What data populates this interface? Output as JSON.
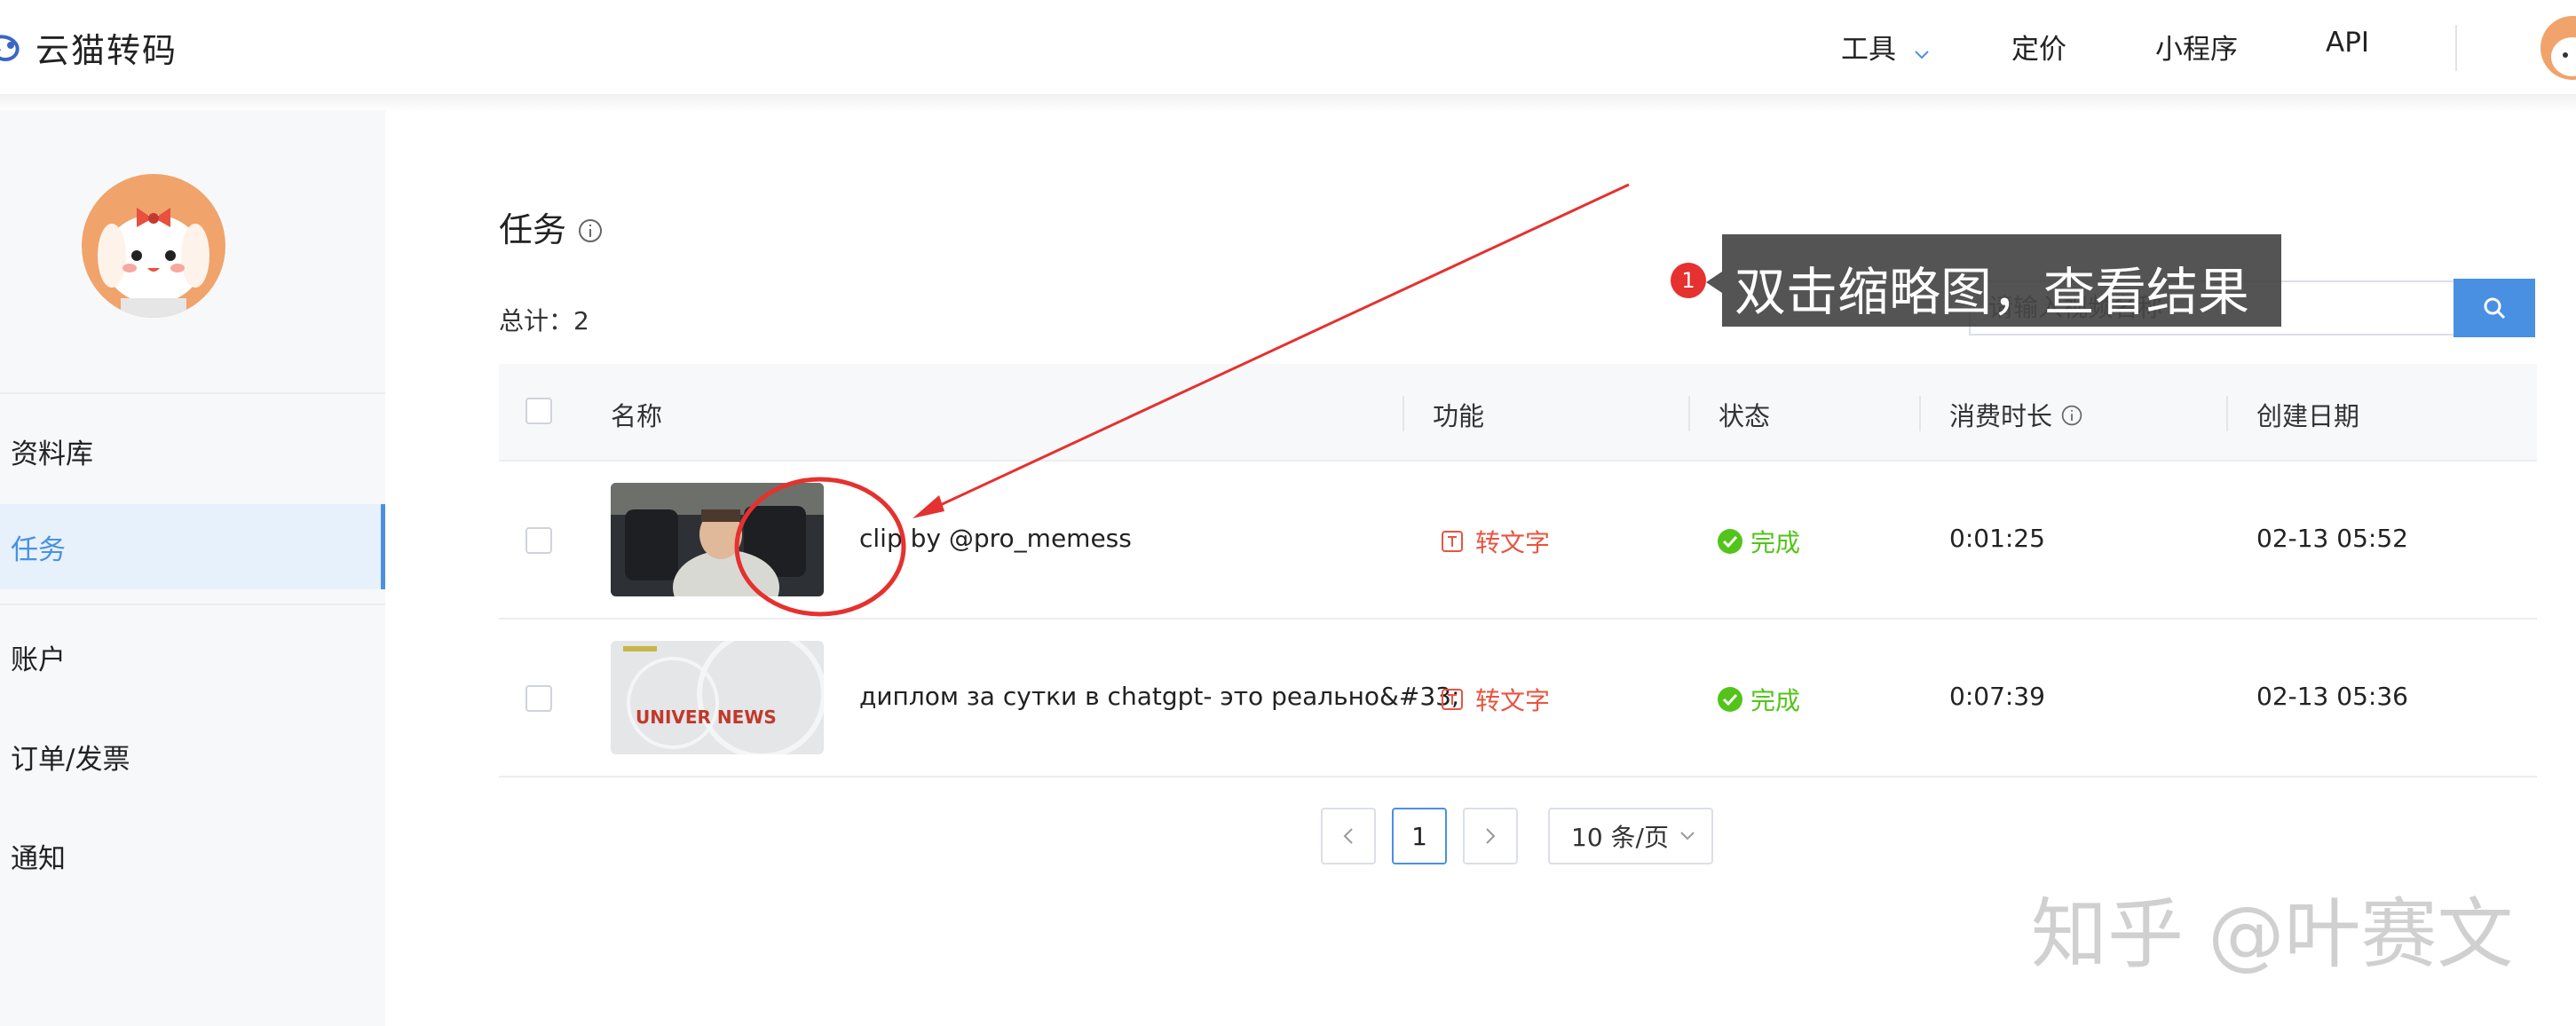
{
  "header": {
    "logo_text": "云猫转码",
    "nav": [
      {
        "label": "工具",
        "has_dropdown": true
      },
      {
        "label": "定价"
      },
      {
        "label": "小程序"
      },
      {
        "label": "API"
      }
    ]
  },
  "sidebar": {
    "items": [
      {
        "label": "资料库",
        "active": false
      },
      {
        "label": "任务",
        "active": true
      },
      {
        "label": "账户",
        "active": false
      },
      {
        "label": "订单/发票",
        "active": false
      },
      {
        "label": "通知",
        "active": false
      }
    ]
  },
  "main": {
    "title": "任务",
    "total_label": "总计：2",
    "search": {
      "placeholder": "请输入视频名称"
    },
    "table": {
      "columns": [
        "名称",
        "功能",
        "状态",
        "消费时长",
        "创建日期"
      ],
      "rows": [
        {
          "name": "clip by @pro_memess",
          "function": "转文字",
          "status": "完成",
          "duration": "0:01:25",
          "created": "02-13 05:52",
          "thumb_text": ""
        },
        {
          "name": "диплом за сутки в chatgpt- это реально&#33;",
          "function": "转文字",
          "status": "完成",
          "duration": "0:07:39",
          "created": "02-13 05:36",
          "thumb_text": "UNIVER NEWS"
        }
      ]
    },
    "pagination": {
      "current": "1",
      "page_size": "10 条/页"
    }
  },
  "annotation": {
    "step": "1",
    "text": "双击缩略图，查看结果"
  },
  "watermark": "知乎 @叶赛文",
  "colors": {
    "accent": "#4a90e2",
    "func": "#e8543f",
    "success": "#52c41a",
    "annotation_red": "#e5312f"
  }
}
